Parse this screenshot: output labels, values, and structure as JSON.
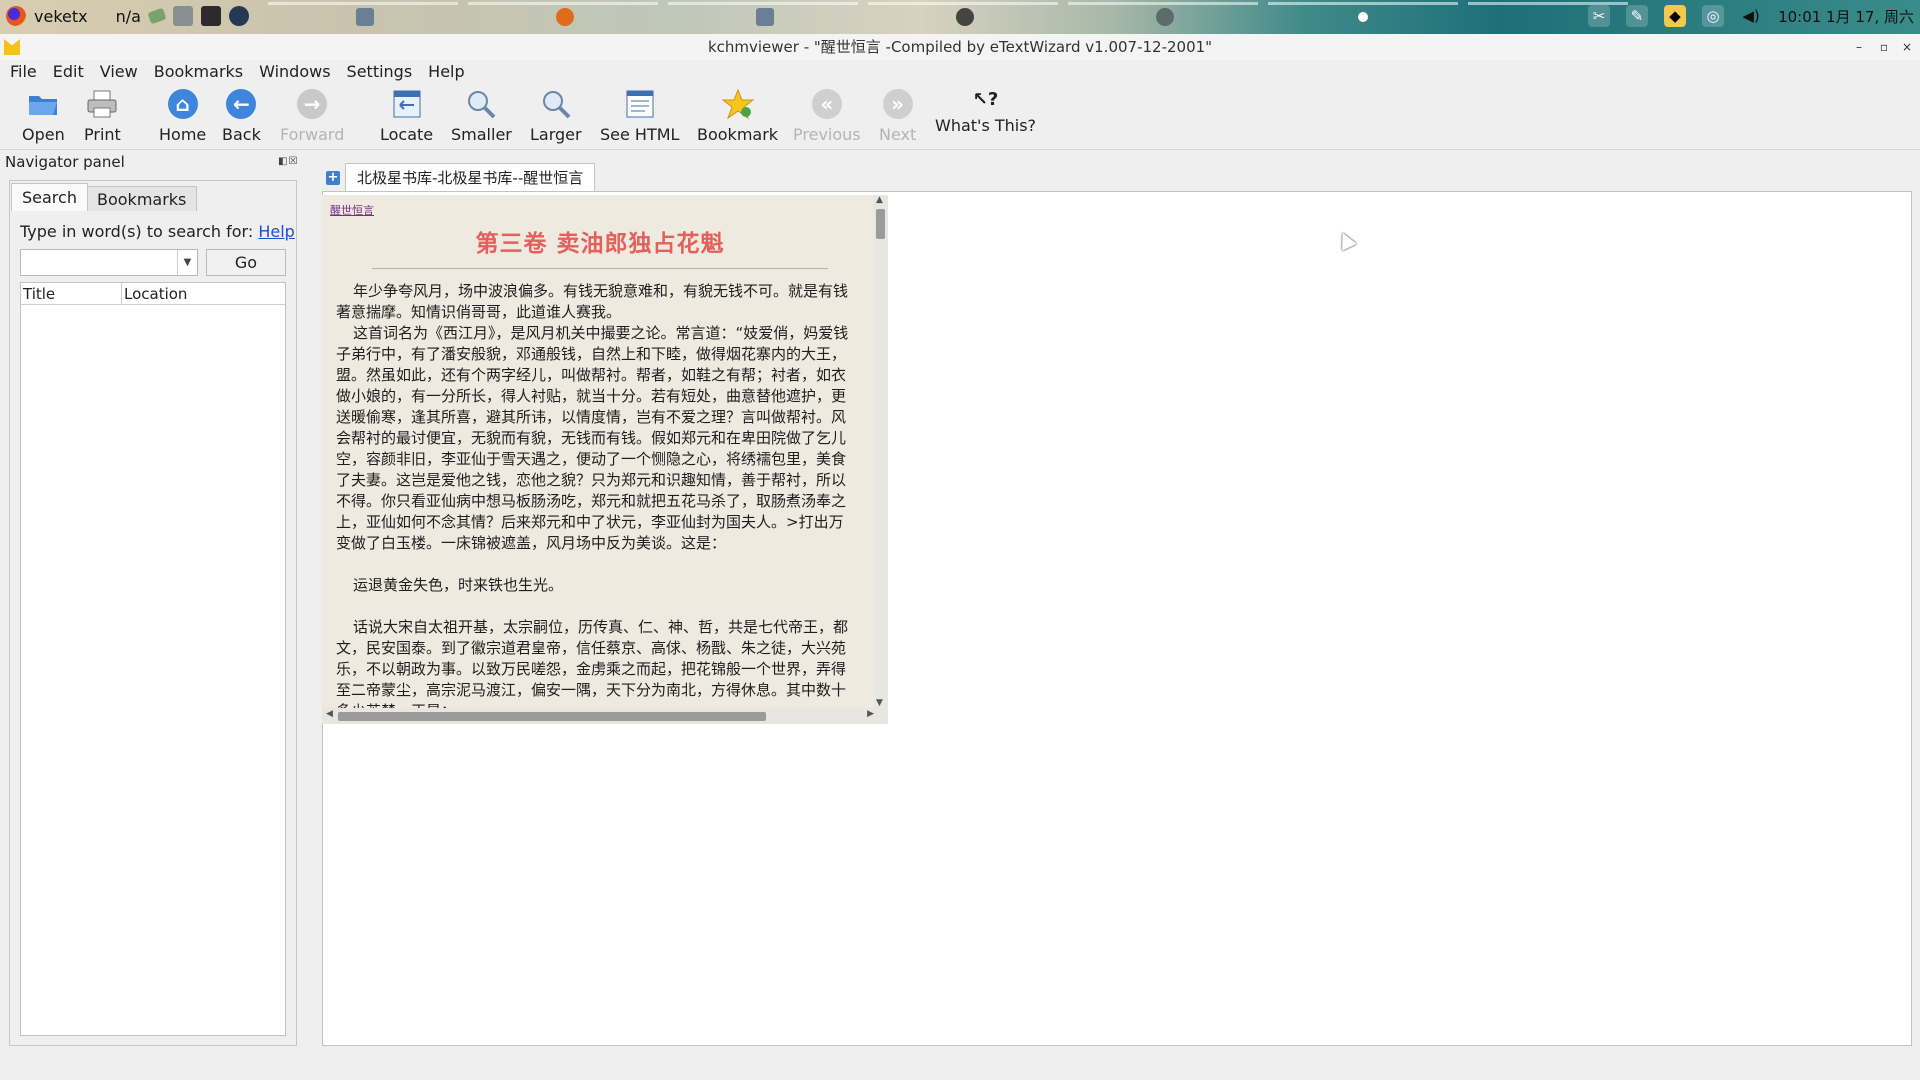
{
  "taskbar": {
    "left_label": "veketx",
    "status": "n/a",
    "clock": "10:01 1月 17, 周六"
  },
  "window": {
    "title": "kchmviewer - \"醒世恒言  -Compiled by eTextWizard v1.007-12-2001\"",
    "controls": [
      "–",
      "▫",
      "×"
    ]
  },
  "menubar": [
    "File",
    "Edit",
    "View",
    "Bookmarks",
    "Windows",
    "Settings",
    "Help"
  ],
  "toolbar": {
    "open": "Open",
    "print": "Print",
    "home": "Home",
    "back": "Back",
    "forward": "Forward",
    "locate": "Locate",
    "smaller": "Smaller",
    "larger": "Larger",
    "see_html": "See HTML",
    "bookmark": "Bookmark",
    "previous": "Previous",
    "next": "Next",
    "whats_this": "What's This?"
  },
  "navigator": {
    "title": "Navigator panel",
    "tabs": [
      "Search",
      "Bookmarks"
    ],
    "search_prompt": "Type in word(s) to search for:",
    "help_link": "Help",
    "search_value": "",
    "go_label": "Go",
    "columns": [
      "Title",
      "Location"
    ]
  },
  "document": {
    "tab_label": "北极星书库-北极星书库--醒世恒言",
    "book_link": "醒世恒言",
    "chapter_title": "第三卷    卖油郎独占花魁",
    "lines": [
      {
        "text": "年少争夸风月，场中波浪偏多。有钱无貌意难和，有貌无钱不可。就是有钱",
        "indent": true
      },
      {
        "text": "著意揣摩。知情识俏哥哥，此道谁人赛我。",
        "indent": false
      },
      {
        "text": "这首词名为《西江月》，是风月机关中撮要之论。常言道：“妓爱俏，妈爱钱",
        "indent": true
      },
      {
        "text": "子弟行中，有了潘安般貌，邓通般钱，自然上和下睦，做得烟花寨内的大王，",
        "indent": false
      },
      {
        "text": "盟。然虽如此，还有个两字经儿，叫做帮衬。帮者，如鞋之有帮；衬者，如衣",
        "indent": false
      },
      {
        "text": "做小娘的，有一分所长，得人衬贴，就当十分。若有短处，曲意替他遮护，更",
        "indent": false
      },
      {
        "text": "送暖偷寒，逢其所喜，避其所讳，以情度情，岂有不爱之理？言叫做帮衬。风",
        "indent": false
      },
      {
        "text": "会帮衬的最讨便宜，无貌而有貌，无钱而有钱。假如郑元和在卑田院做了乞儿",
        "indent": false
      },
      {
        "text": "空，容颜非旧，李亚仙于雪天遇之，便动了一个恻隐之心，将绣襦包里，美食",
        "indent": false
      },
      {
        "text": "了夫妻。这岂是爱他之钱，恋他之貌？只为郑元和识趣知情，善于帮衬，所以",
        "indent": false
      },
      {
        "text": "不得。你只看亚仙病中想马板肠汤吃，郑元和就把五花马杀了，取肠煮汤奉之",
        "indent": false
      },
      {
        "text": "上，亚仙如何不念其情？后来郑元和中了状元，李亚仙封为国夫人。>打出万",
        "indent": false
      },
      {
        "text": "变做了白玉楼。一床锦被遮盖，风月场中反为美谈。这是：",
        "indent": false
      },
      {
        "text": "",
        "indent": false
      },
      {
        "text": "运退黄金失色，时来铁也生光。",
        "indent": true
      },
      {
        "text": "",
        "indent": false
      },
      {
        "text": "话说大宋自太祖开基，太宗嗣位，历传真、仁、神、哲，共是七代帝王，都",
        "indent": true
      },
      {
        "text": "文，民安国泰。到了徽宗道君皇帝，信任蔡京、高俅、杨戬、朱之徒，大兴苑",
        "indent": false
      },
      {
        "text": "乐，不以朝政为事。以致万民嗟怨，金虏乘之而起，把花锦般一个世界，弄得",
        "indent": false
      },
      {
        "text": "至二帝蒙尘，高宗泥马渡江，偏安一隅，天下分为南北，方得休息。其中数十",
        "indent": false
      },
      {
        "text": "多少苦楚。正是：",
        "indent": false
      }
    ]
  }
}
